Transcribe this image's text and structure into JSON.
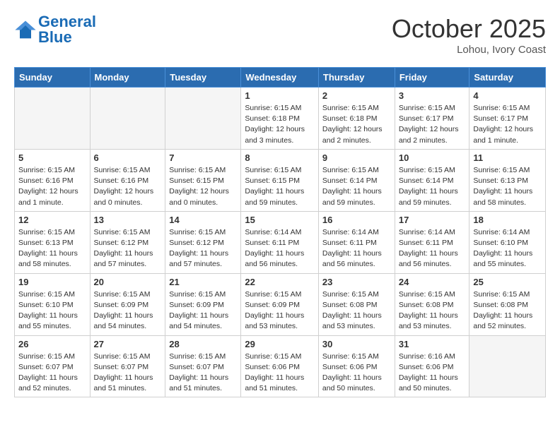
{
  "header": {
    "logo_general": "General",
    "logo_blue": "Blue",
    "month": "October 2025",
    "location": "Lohou, Ivory Coast"
  },
  "weekdays": [
    "Sunday",
    "Monday",
    "Tuesday",
    "Wednesday",
    "Thursday",
    "Friday",
    "Saturday"
  ],
  "weeks": [
    [
      {
        "day": "",
        "info": ""
      },
      {
        "day": "",
        "info": ""
      },
      {
        "day": "",
        "info": ""
      },
      {
        "day": "1",
        "info": "Sunrise: 6:15 AM\nSunset: 6:18 PM\nDaylight: 12 hours\nand 3 minutes."
      },
      {
        "day": "2",
        "info": "Sunrise: 6:15 AM\nSunset: 6:18 PM\nDaylight: 12 hours\nand 2 minutes."
      },
      {
        "day": "3",
        "info": "Sunrise: 6:15 AM\nSunset: 6:17 PM\nDaylight: 12 hours\nand 2 minutes."
      },
      {
        "day": "4",
        "info": "Sunrise: 6:15 AM\nSunset: 6:17 PM\nDaylight: 12 hours\nand 1 minute."
      }
    ],
    [
      {
        "day": "5",
        "info": "Sunrise: 6:15 AM\nSunset: 6:16 PM\nDaylight: 12 hours\nand 1 minute."
      },
      {
        "day": "6",
        "info": "Sunrise: 6:15 AM\nSunset: 6:16 PM\nDaylight: 12 hours\nand 0 minutes."
      },
      {
        "day": "7",
        "info": "Sunrise: 6:15 AM\nSunset: 6:15 PM\nDaylight: 12 hours\nand 0 minutes."
      },
      {
        "day": "8",
        "info": "Sunrise: 6:15 AM\nSunset: 6:15 PM\nDaylight: 11 hours\nand 59 minutes."
      },
      {
        "day": "9",
        "info": "Sunrise: 6:15 AM\nSunset: 6:14 PM\nDaylight: 11 hours\nand 59 minutes."
      },
      {
        "day": "10",
        "info": "Sunrise: 6:15 AM\nSunset: 6:14 PM\nDaylight: 11 hours\nand 59 minutes."
      },
      {
        "day": "11",
        "info": "Sunrise: 6:15 AM\nSunset: 6:13 PM\nDaylight: 11 hours\nand 58 minutes."
      }
    ],
    [
      {
        "day": "12",
        "info": "Sunrise: 6:15 AM\nSunset: 6:13 PM\nDaylight: 11 hours\nand 58 minutes."
      },
      {
        "day": "13",
        "info": "Sunrise: 6:15 AM\nSunset: 6:12 PM\nDaylight: 11 hours\nand 57 minutes."
      },
      {
        "day": "14",
        "info": "Sunrise: 6:15 AM\nSunset: 6:12 PM\nDaylight: 11 hours\nand 57 minutes."
      },
      {
        "day": "15",
        "info": "Sunrise: 6:14 AM\nSunset: 6:11 PM\nDaylight: 11 hours\nand 56 minutes."
      },
      {
        "day": "16",
        "info": "Sunrise: 6:14 AM\nSunset: 6:11 PM\nDaylight: 11 hours\nand 56 minutes."
      },
      {
        "day": "17",
        "info": "Sunrise: 6:14 AM\nSunset: 6:11 PM\nDaylight: 11 hours\nand 56 minutes."
      },
      {
        "day": "18",
        "info": "Sunrise: 6:14 AM\nSunset: 6:10 PM\nDaylight: 11 hours\nand 55 minutes."
      }
    ],
    [
      {
        "day": "19",
        "info": "Sunrise: 6:15 AM\nSunset: 6:10 PM\nDaylight: 11 hours\nand 55 minutes."
      },
      {
        "day": "20",
        "info": "Sunrise: 6:15 AM\nSunset: 6:09 PM\nDaylight: 11 hours\nand 54 minutes."
      },
      {
        "day": "21",
        "info": "Sunrise: 6:15 AM\nSunset: 6:09 PM\nDaylight: 11 hours\nand 54 minutes."
      },
      {
        "day": "22",
        "info": "Sunrise: 6:15 AM\nSunset: 6:09 PM\nDaylight: 11 hours\nand 53 minutes."
      },
      {
        "day": "23",
        "info": "Sunrise: 6:15 AM\nSunset: 6:08 PM\nDaylight: 11 hours\nand 53 minutes."
      },
      {
        "day": "24",
        "info": "Sunrise: 6:15 AM\nSunset: 6:08 PM\nDaylight: 11 hours\nand 53 minutes."
      },
      {
        "day": "25",
        "info": "Sunrise: 6:15 AM\nSunset: 6:08 PM\nDaylight: 11 hours\nand 52 minutes."
      }
    ],
    [
      {
        "day": "26",
        "info": "Sunrise: 6:15 AM\nSunset: 6:07 PM\nDaylight: 11 hours\nand 52 minutes."
      },
      {
        "day": "27",
        "info": "Sunrise: 6:15 AM\nSunset: 6:07 PM\nDaylight: 11 hours\nand 51 minutes."
      },
      {
        "day": "28",
        "info": "Sunrise: 6:15 AM\nSunset: 6:07 PM\nDaylight: 11 hours\nand 51 minutes."
      },
      {
        "day": "29",
        "info": "Sunrise: 6:15 AM\nSunset: 6:06 PM\nDaylight: 11 hours\nand 51 minutes."
      },
      {
        "day": "30",
        "info": "Sunrise: 6:15 AM\nSunset: 6:06 PM\nDaylight: 11 hours\nand 50 minutes."
      },
      {
        "day": "31",
        "info": "Sunrise: 6:16 AM\nSunset: 6:06 PM\nDaylight: 11 hours\nand 50 minutes."
      },
      {
        "day": "",
        "info": ""
      }
    ]
  ]
}
